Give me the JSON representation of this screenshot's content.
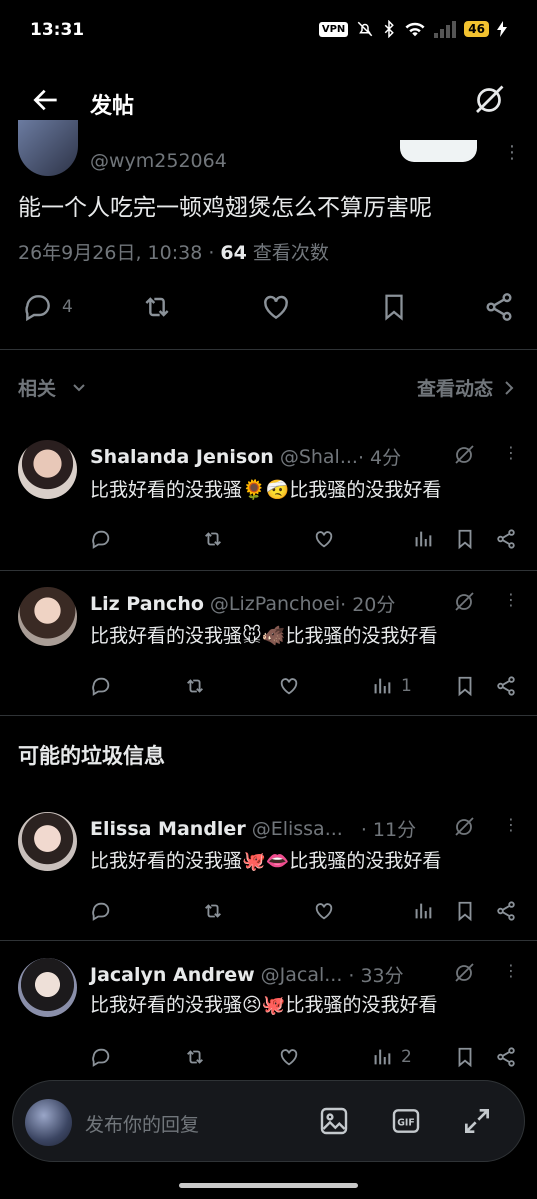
{
  "status_bar": {
    "time": "13:31",
    "vpn": "VPN",
    "battery": "46"
  },
  "header": {
    "title": "发帖",
    "back_icon": "back-arrow-icon",
    "right_icon": "grok-icon"
  },
  "post": {
    "handle": "@wym252064",
    "text": "能一个人吃完一顿鸡翅煲怎么不算厉害呢",
    "timestamp": "26年9月26日, 10:38 · ",
    "views_count": "64",
    "views_label": " 查看次数",
    "actions": {
      "reply_count": "4"
    }
  },
  "related": {
    "label": "相关",
    "activity_label": "查看动态"
  },
  "replies_top": [
    {
      "name": "Shalanda Jenison",
      "handle": "@Shal...",
      "time": " · 4分",
      "text": "比我好看的没我骚🌻🤕比我骚的没我好看",
      "views": ""
    },
    {
      "name": "Liz Pancho",
      "handle": "@LizPanchoei",
      "time": " · 20分",
      "text": "比我好看的没我骚🐭🐗比我骚的没我好看",
      "views": "1"
    }
  ],
  "spam_section": {
    "title": "可能的垃圾信息"
  },
  "replies_spam": [
    {
      "name": "Elissa Mandler",
      "handle": "@Elissa...",
      "time": " · 11分",
      "text": "比我好看的没我骚🐙👄比我骚的没我好看",
      "views": ""
    },
    {
      "name": "Jacalyn Andrew",
      "handle": "@Jacal...",
      "time": " · 33分",
      "text": "比我好看的没我骚😣🐙比我骚的没我好看",
      "views": "2"
    }
  ],
  "composer": {
    "placeholder": "发布你的回复"
  },
  "colors": {
    "background": "#000000",
    "text": "#e7e9ea",
    "muted": "#71767b",
    "divider": "#2f3336",
    "battery": "#f2c230"
  }
}
